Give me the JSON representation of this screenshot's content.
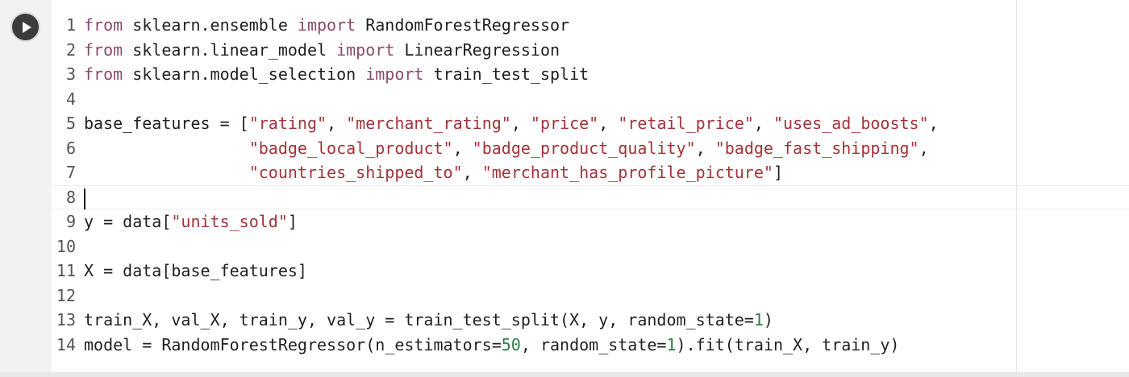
{
  "run_button": {
    "icon": "play-icon"
  },
  "lines": [
    {
      "n": "1",
      "tokens": [
        {
          "t": "kw",
          "v": "from"
        },
        {
          "t": "p",
          "v": " sklearn.ensemble "
        },
        {
          "t": "kw",
          "v": "import"
        },
        {
          "t": "p",
          "v": " RandomForestRegressor"
        }
      ]
    },
    {
      "n": "2",
      "tokens": [
        {
          "t": "kw",
          "v": "from"
        },
        {
          "t": "p",
          "v": " sklearn.linear_model "
        },
        {
          "t": "kw",
          "v": "import"
        },
        {
          "t": "p",
          "v": " LinearRegression"
        }
      ]
    },
    {
      "n": "3",
      "tokens": [
        {
          "t": "kw",
          "v": "from"
        },
        {
          "t": "p",
          "v": " sklearn.model_selection "
        },
        {
          "t": "kw",
          "v": "import"
        },
        {
          "t": "p",
          "v": " train_test_split"
        }
      ]
    },
    {
      "n": "4",
      "tokens": []
    },
    {
      "n": "5",
      "tokens": [
        {
          "t": "p",
          "v": "base_features = ["
        },
        {
          "t": "str",
          "v": "\"rating\""
        },
        {
          "t": "p",
          "v": ", "
        },
        {
          "t": "str",
          "v": "\"merchant_rating\""
        },
        {
          "t": "p",
          "v": ", "
        },
        {
          "t": "str",
          "v": "\"price\""
        },
        {
          "t": "p",
          "v": ", "
        },
        {
          "t": "str",
          "v": "\"retail_price\""
        },
        {
          "t": "p",
          "v": ", "
        },
        {
          "t": "str",
          "v": "\"uses_ad_boosts\""
        },
        {
          "t": "p",
          "v": ","
        }
      ]
    },
    {
      "n": "6",
      "tokens": [
        {
          "t": "p",
          "v": "                 "
        },
        {
          "t": "str",
          "v": "\"badge_local_product\""
        },
        {
          "t": "p",
          "v": ", "
        },
        {
          "t": "str",
          "v": "\"badge_product_quality\""
        },
        {
          "t": "p",
          "v": ", "
        },
        {
          "t": "str",
          "v": "\"badge_fast_shipping\""
        },
        {
          "t": "p",
          "v": ","
        }
      ]
    },
    {
      "n": "7",
      "tokens": [
        {
          "t": "p",
          "v": "                 "
        },
        {
          "t": "str",
          "v": "\"countries_shipped_to\""
        },
        {
          "t": "p",
          "v": ", "
        },
        {
          "t": "str",
          "v": "\"merchant_has_profile_picture\""
        },
        {
          "t": "p",
          "v": "]"
        }
      ]
    },
    {
      "n": "8",
      "tokens": [],
      "cursor": true
    },
    {
      "n": "9",
      "tokens": [
        {
          "t": "p",
          "v": "y = data["
        },
        {
          "t": "str",
          "v": "\"units_sold\""
        },
        {
          "t": "p",
          "v": "]"
        }
      ]
    },
    {
      "n": "10",
      "tokens": []
    },
    {
      "n": "11",
      "tokens": [
        {
          "t": "p",
          "v": "X = data[base_features]"
        }
      ]
    },
    {
      "n": "12",
      "tokens": []
    },
    {
      "n": "13",
      "tokens": [
        {
          "t": "p",
          "v": "train_X, val_X, train_y, val_y = train_test_split(X, y, random_state="
        },
        {
          "t": "num",
          "v": "1"
        },
        {
          "t": "p",
          "v": ")"
        }
      ]
    },
    {
      "n": "14",
      "tokens": [
        {
          "t": "p",
          "v": "model = RandomForestRegressor(n_estimators="
        },
        {
          "t": "num",
          "v": "50"
        },
        {
          "t": "p",
          "v": ", random_state="
        },
        {
          "t": "num",
          "v": "1"
        },
        {
          "t": "p",
          "v": ").fit(train_X, train_y)"
        }
      ]
    }
  ],
  "colors": {
    "keyword": "#8c4a6b",
    "string": "#a3333a",
    "number": "#2e7d48",
    "plain": "#1f1f1f"
  }
}
